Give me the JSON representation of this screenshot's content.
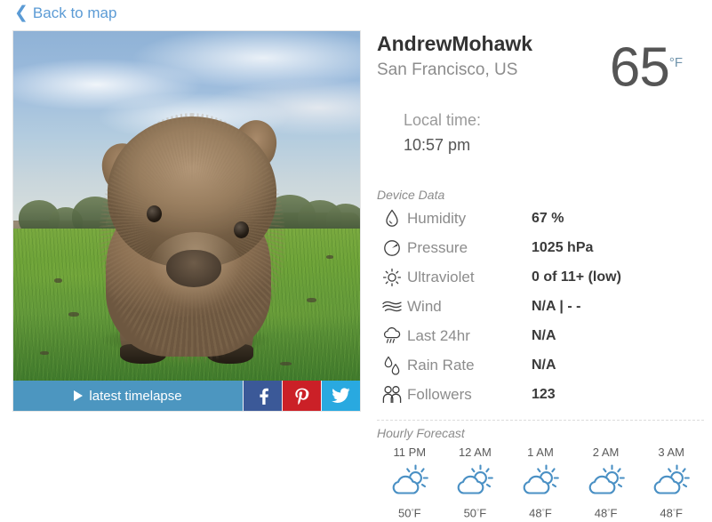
{
  "nav": {
    "back_label": "Back to map",
    "back_icon": "chevron-left-icon"
  },
  "photo": {
    "alt": "wombat standing in a grassy field",
    "timelapse_label": "latest timelapse",
    "play_icon": "play-icon",
    "social": [
      {
        "name": "facebook",
        "icon": "facebook-icon",
        "color": "#3b5998",
        "glyph": "f"
      },
      {
        "name": "pinterest",
        "icon": "pinterest-icon",
        "color": "#cb2027",
        "glyph": "P"
      },
      {
        "name": "twitter",
        "icon": "twitter-icon",
        "color": "#29a9e0",
        "glyph": "t"
      }
    ]
  },
  "station": {
    "name": "AndrewMohawk",
    "location": "San Francisco, US",
    "local_time_label": "Local time:",
    "local_time_value": "10:57 pm",
    "temperature": "65",
    "temperature_unit": "°F"
  },
  "device_data": {
    "title": "Device Data",
    "rows": [
      {
        "icon": "droplet-icon",
        "label": "Humidity",
        "value": "67 %"
      },
      {
        "icon": "gauge-icon",
        "label": "Pressure",
        "value": "1025 hPa"
      },
      {
        "icon": "sun-icon",
        "label": "Ultraviolet",
        "value": "0 of 11+ (low)"
      },
      {
        "icon": "wind-icon",
        "label": "Wind",
        "value": "N/A | - -"
      },
      {
        "icon": "rain-cloud-icon",
        "label": "Last 24hr",
        "value": "N/A"
      },
      {
        "icon": "raindrops-icon",
        "label": "Rain Rate",
        "value": "N/A"
      },
      {
        "icon": "people-icon",
        "label": "Followers",
        "value": "123"
      }
    ]
  },
  "forecast": {
    "title": "Hourly Forecast",
    "hours": [
      {
        "time": "11 PM",
        "icon": "partly-cloudy-icon",
        "temp": "50",
        "unit": "F"
      },
      {
        "time": "12 AM",
        "icon": "partly-cloudy-icon",
        "temp": "50",
        "unit": "F"
      },
      {
        "time": "1 AM",
        "icon": "partly-cloudy-icon",
        "temp": "48",
        "unit": "F"
      },
      {
        "time": "2 AM",
        "icon": "partly-cloudy-icon",
        "temp": "48",
        "unit": "F"
      },
      {
        "time": "3 AM",
        "icon": "partly-cloudy-icon",
        "temp": "48",
        "unit": "F"
      }
    ]
  },
  "colors": {
    "link": "#5b9bd5",
    "timelapse_bar": "#4c96c0",
    "forecast_icon": "#4a90c4",
    "value_text": "#3a3a3a",
    "label_text": "#8c8c8c"
  }
}
